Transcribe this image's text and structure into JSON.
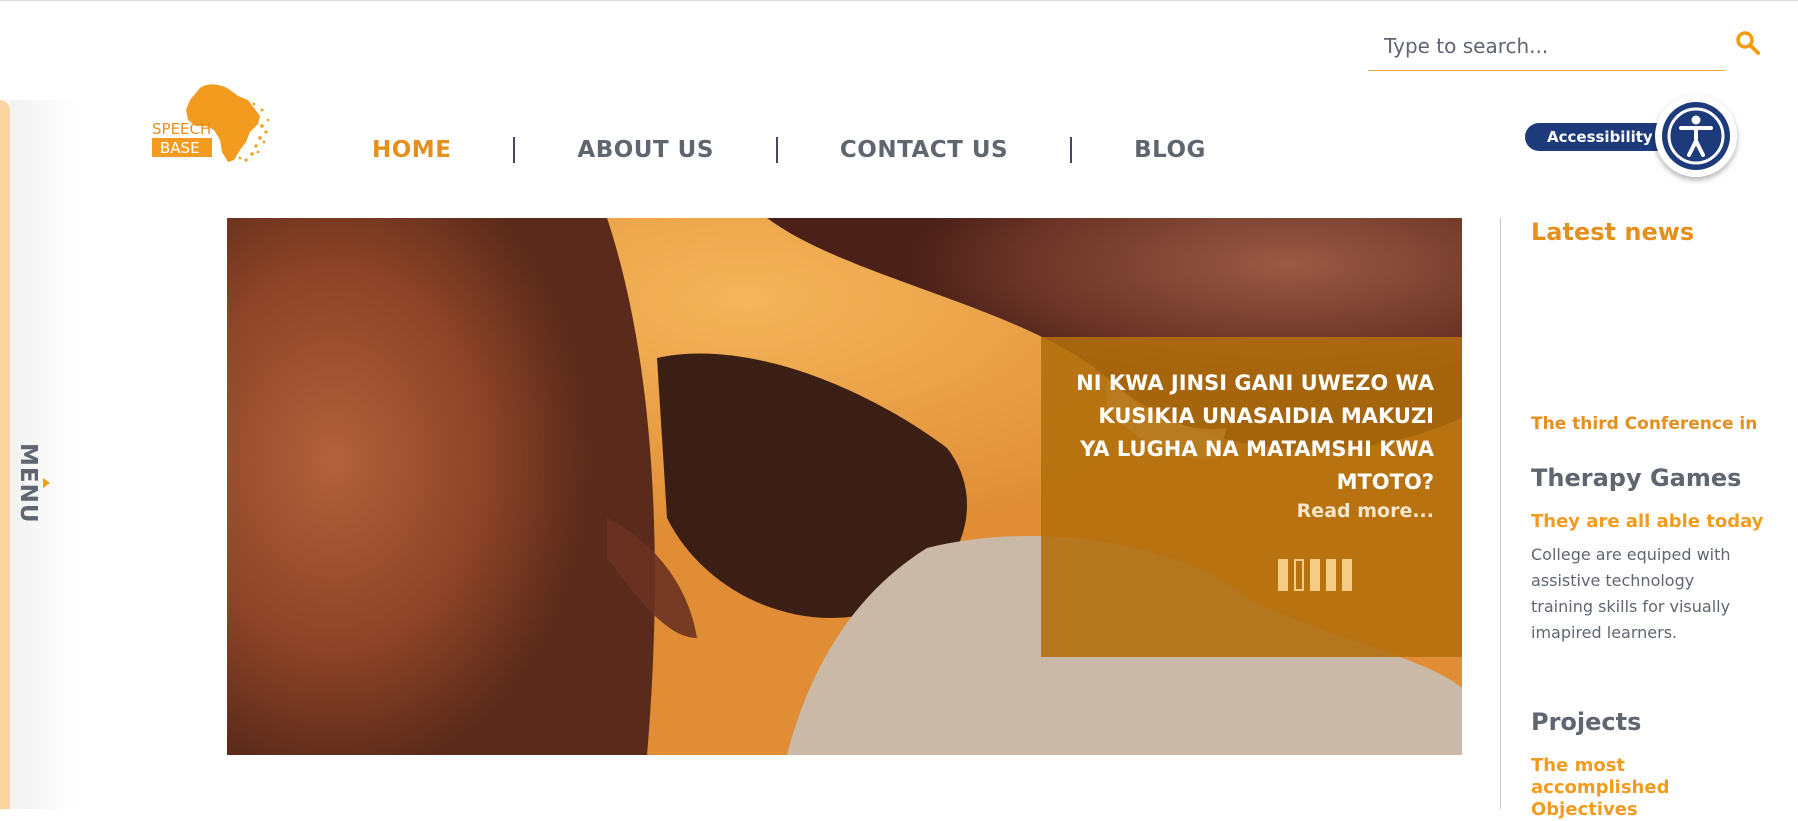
{
  "search": {
    "placeholder": "Type to search..."
  },
  "logo": {
    "line1": "SPEECH",
    "line2": "BASE"
  },
  "nav": {
    "items": [
      {
        "label": "HOME",
        "active": true
      },
      {
        "label": "ABOUT US",
        "active": false
      },
      {
        "label": "CONTACT US",
        "active": false
      },
      {
        "label": "BLOG",
        "active": false
      }
    ]
  },
  "accessibility": {
    "label": "Accessibility"
  },
  "side_menu": {
    "label": "MENU"
  },
  "hero": {
    "caption_title": "NI KWA JINSI GANI UWEZO WA KUSIKIA UNASAIDIA MAKUZI YA LUGHA NA MATAMSHI KWA MTOTO?",
    "read_more": "Read more...",
    "slides": 5,
    "active_slide": 2
  },
  "sidebar": {
    "latest_news": {
      "title": "Latest news",
      "ticker": "The third Conference in"
    },
    "therapy_games": {
      "title": "Therapy Games",
      "subtitle": "They are all able today",
      "text": "College are equiped with assistive technology training skills for visually imapired learners."
    },
    "projects": {
      "title": "Projects",
      "subtitle": "The most accomplished Objectives"
    }
  },
  "colors": {
    "accent": "#e58f1f",
    "text": "#5f6670",
    "accessibility_blue": "#1d3a7a",
    "caption_bg": "#b26e0b"
  }
}
